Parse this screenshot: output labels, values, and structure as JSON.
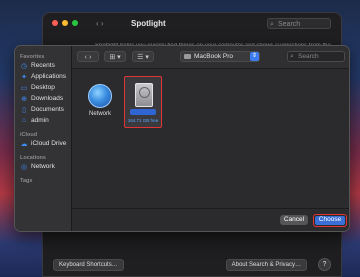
{
  "background_window": {
    "title": "Spotlight",
    "search_placeholder": "Search",
    "description": "Spotlight helps you quickly find things on your computer and shows suggestions from the",
    "keyboard_shortcuts_button": "Keyboard Shortcuts…",
    "about_search_button": "About Search & Privacy…",
    "help_button": "?"
  },
  "dialog": {
    "sidebar": {
      "sections": [
        {
          "title": "Favorites",
          "items": [
            {
              "label": "Recents",
              "icon": "clock-icon"
            },
            {
              "label": "Applications",
              "icon": "applications-icon"
            },
            {
              "label": "Desktop",
              "icon": "desktop-icon"
            },
            {
              "label": "Downloads",
              "icon": "downloads-icon"
            },
            {
              "label": "Documents",
              "icon": "documents-icon"
            },
            {
              "label": "admin",
              "icon": "home-icon"
            }
          ]
        },
        {
          "title": "iCloud",
          "items": [
            {
              "label": "iCloud Drive",
              "icon": "cloud-icon"
            }
          ]
        },
        {
          "title": "Locations",
          "items": [
            {
              "label": "Network",
              "icon": "network-icon"
            }
          ]
        },
        {
          "title": "Tags",
          "items": []
        }
      ]
    },
    "toolbar": {
      "location": "MacBook Pro",
      "search_placeholder": "Search"
    },
    "items": [
      {
        "label": "Network",
        "icon": "network-globe-icon"
      },
      {
        "label": "",
        "icon": "hard-disk-icon",
        "info": "164.71 GB free",
        "selected": true
      }
    ],
    "buttons": {
      "cancel": "Cancel",
      "choose": "Choose"
    }
  },
  "colors": {
    "accent": "#3a6fd8",
    "highlight": "#e23434"
  }
}
